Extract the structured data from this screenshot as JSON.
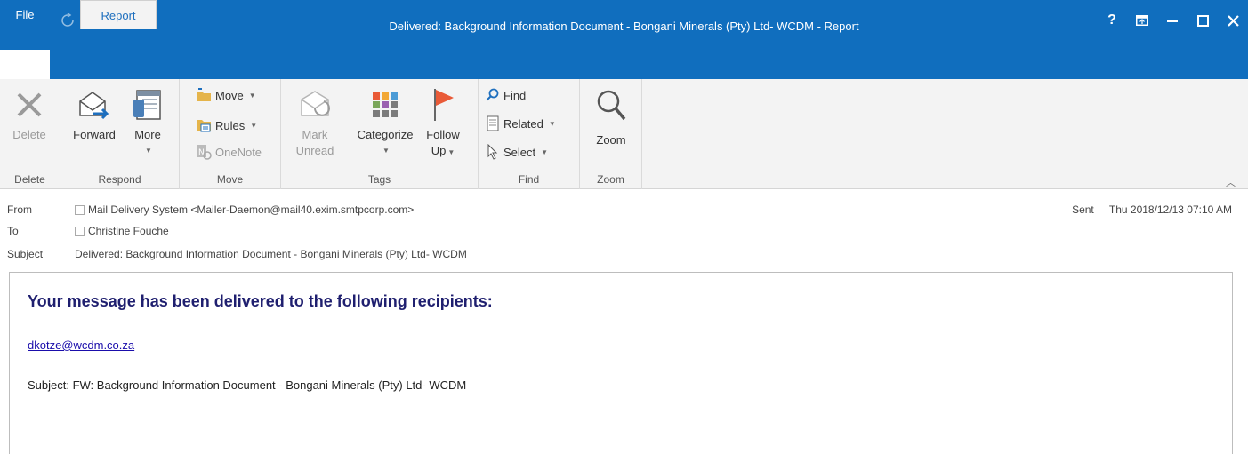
{
  "window": {
    "title": "Delivered: Background Information Document - Bongani Minerals (Pty) Ltd- WCDM - Report",
    "controls": [
      "?",
      "⧉",
      "–",
      "☐",
      "✕"
    ]
  },
  "qat": {
    "icons": [
      "save-icon",
      "undo-icon",
      "redo-icon",
      "up-icon",
      "down-icon",
      "customize-icon"
    ]
  },
  "tabs": {
    "file": "File",
    "report": "Report"
  },
  "ribbon": {
    "delete": {
      "button": "Delete",
      "group": "Delete"
    },
    "respond": {
      "forward": "Forward",
      "more": "More",
      "group": "Respond"
    },
    "move": {
      "move": "Move",
      "rules": "Rules",
      "onenote": "OneNote",
      "group": "Move"
    },
    "tags": {
      "mark_unread_1": "Mark",
      "mark_unread_2": "Unread",
      "categorize": "Categorize",
      "follow_up_1": "Follow",
      "follow_up_2": "Up",
      "group": "Tags"
    },
    "find": {
      "find": "Find",
      "related": "Related",
      "select": "Select",
      "group": "Find"
    },
    "zoom": {
      "button": "Zoom",
      "group": "Zoom"
    }
  },
  "header": {
    "from_label": "From",
    "from_value": "Mail Delivery System <Mailer-Daemon@mail40.exim.smtpcorp.com>",
    "to_label": "To",
    "to_value": "Christine Fouche",
    "subject_label": "Subject",
    "subject_value": "Delivered: Background Information Document - Bongani Minerals (Pty) Ltd- WCDM",
    "sent_label": "Sent",
    "sent_value": "Thu 2018/12/13 07:10 AM"
  },
  "message": {
    "title": "Your message has been delivered to the following recipients:",
    "recipient": "dkotze@wcdm.co.za",
    "subject_line": "Subject: FW: Background Information Document - Bongani Minerals (Pty) Ltd- WCDM"
  }
}
